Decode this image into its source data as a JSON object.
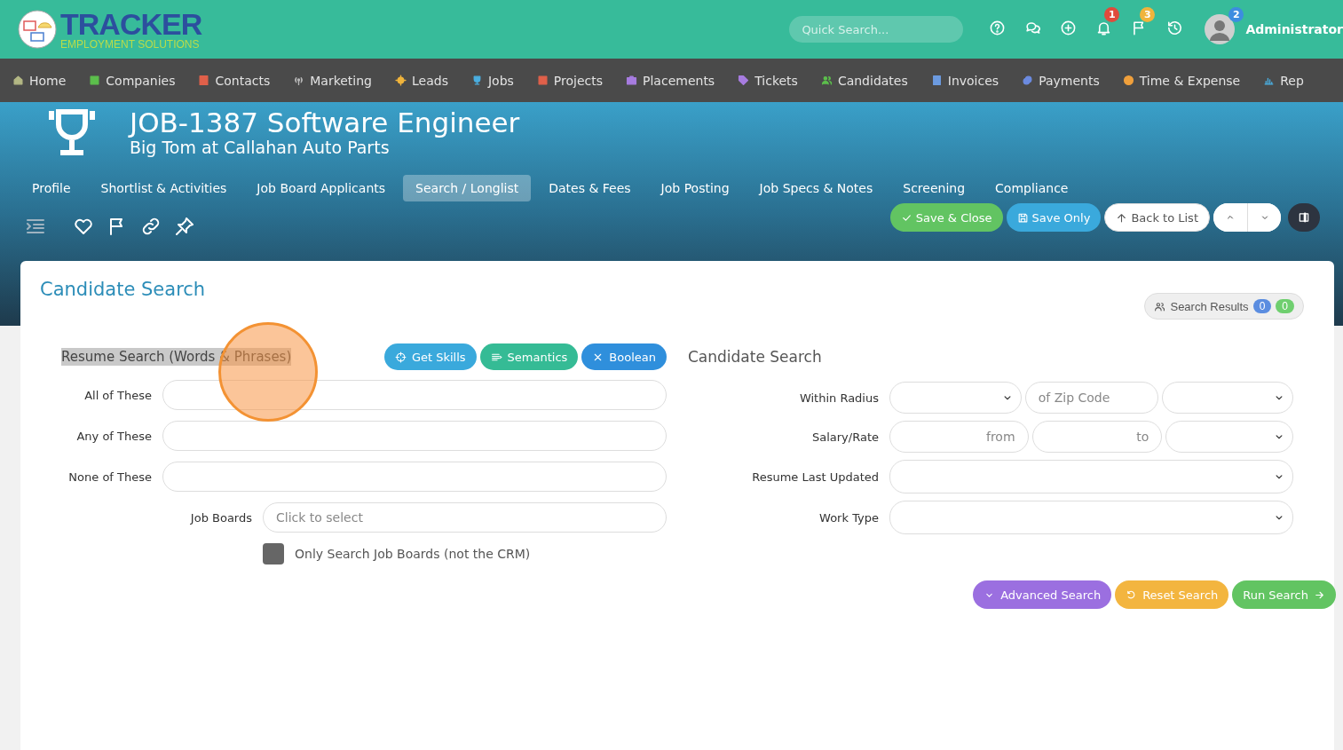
{
  "header": {
    "logo": {
      "title": "TRACKER",
      "tagline": "EMPLOYMENT SOLUTIONS"
    },
    "search": {
      "placeholder": "Quick Search..."
    },
    "alerts": [
      {
        "count": "1",
        "color": "#e04b3c"
      },
      {
        "count": "3",
        "color": "#f0b43c"
      }
    ],
    "user": {
      "name": "Administrator",
      "badge": {
        "count": "2",
        "color": "#3d8de0"
      }
    }
  },
  "nav": [
    {
      "label": "Home",
      "color": "#b3b784"
    },
    {
      "label": "Companies",
      "color": "#5cbf4c"
    },
    {
      "label": "Contacts",
      "color": "#e0604a"
    },
    {
      "label": "Marketing",
      "color": "#b9b9b9"
    },
    {
      "label": "Leads",
      "color": "#f0b43c"
    },
    {
      "label": "Jobs",
      "color": "#4aaee0"
    },
    {
      "label": "Projects",
      "color": "#e0604a"
    },
    {
      "label": "Placements",
      "color": "#a77ce0"
    },
    {
      "label": "Tickets",
      "color": "#a77ce0"
    },
    {
      "label": "Candidates",
      "color": "#5cbf4c"
    },
    {
      "label": "Invoices",
      "color": "#6c9be0"
    },
    {
      "label": "Payments",
      "color": "#6c8be0"
    },
    {
      "label": "Time & Expense",
      "color": "#f0a03c"
    },
    {
      "label": "Rep",
      "color": "#4aaee0"
    }
  ],
  "job": {
    "title": "JOB-1387 Software Engineer",
    "subtitle": "Big Tom at Callahan Auto Parts"
  },
  "tabs": [
    {
      "label": "Profile",
      "selected": false
    },
    {
      "label": "Shortlist & Activities",
      "selected": false
    },
    {
      "label": "Job Board Applicants",
      "selected": false
    },
    {
      "label": "Search / Longlist",
      "selected": true
    },
    {
      "label": "Dates & Fees",
      "selected": false
    },
    {
      "label": "Job Posting",
      "selected": false
    },
    {
      "label": "Job Specs & Notes",
      "selected": false
    },
    {
      "label": "Screening",
      "selected": false
    },
    {
      "label": "Compliance",
      "selected": false
    }
  ],
  "actions": [
    {
      "label": "Save & Close",
      "color": "#62c462"
    },
    {
      "label": "Save Only",
      "color": "#3aa9dc"
    },
    {
      "label": "Back to List",
      "color": "#ffffff"
    }
  ],
  "card": {
    "title": "Candidate Search",
    "results": {
      "label": "Search Results",
      "counts": [
        {
          "value": "0",
          "color": "#5b8de0"
        },
        {
          "value": "0",
          "color": "#6fcf6f"
        }
      ]
    },
    "resume": {
      "title": "Resume Search (Words & Phrases)",
      "tools": [
        {
          "label": "Get Skills",
          "color": "#3aa9dc"
        },
        {
          "label": "Semantics",
          "color": "#35bb95"
        },
        {
          "label": "Boolean",
          "color": "#2f8fdc"
        }
      ],
      "fields": [
        {
          "label": "All of These"
        },
        {
          "label": "Any of These"
        },
        {
          "label": "None of These"
        }
      ],
      "job_boards": {
        "label": "Job Boards",
        "placeholder": "Click to select"
      },
      "only_boards": {
        "label": "Only Search Job Boards (not the CRM)",
        "checked": false
      }
    },
    "candidate": {
      "title": "Candidate Search",
      "rows": [
        {
          "label": "Within Radius",
          "fields": [
            {
              "kind": "select"
            },
            {
              "kind": "input",
              "placeholder": "of Zip Code"
            },
            {
              "kind": "select"
            }
          ]
        },
        {
          "label": "Salary/Rate",
          "fields": [
            {
              "kind": "number",
              "placeholder": "from"
            },
            {
              "kind": "number",
              "placeholder": "to"
            },
            {
              "kind": "select"
            }
          ]
        },
        {
          "label": "Resume Last Updated",
          "fields": [
            {
              "kind": "select"
            }
          ]
        },
        {
          "label": "Work Type",
          "fields": [
            {
              "kind": "select"
            }
          ]
        }
      ]
    },
    "buttons": [
      {
        "label": "Advanced Search",
        "color": "#9b6fe0"
      },
      {
        "label": "Reset Search",
        "color": "#f3b53f"
      },
      {
        "label": "Run Search",
        "color": "#62c462"
      }
    ]
  }
}
